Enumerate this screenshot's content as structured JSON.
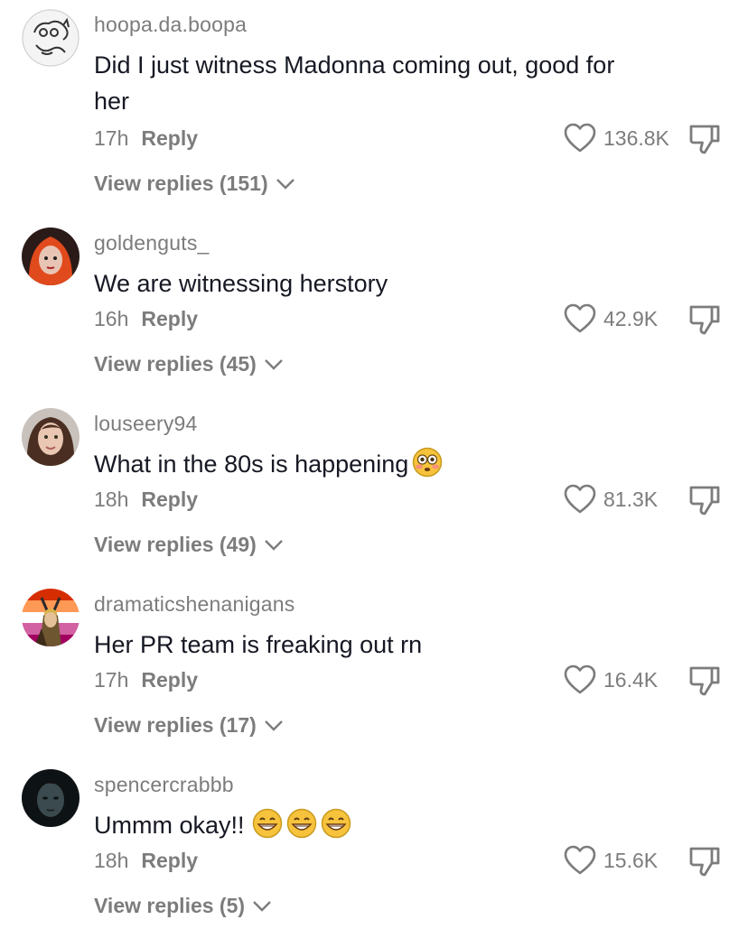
{
  "comments": [
    {
      "username": "hoopa.da.boopa",
      "text": "Did I just witness Madonna coming out, good for her",
      "time": "17h",
      "reply_label": "Reply",
      "likes": "136.8K",
      "view_replies": "View replies (151)",
      "avatar_icon": "cartoon-doodle-avatar"
    },
    {
      "username": "goldenguts_",
      "text": "We are witnessing herstory",
      "time": "16h",
      "reply_label": "Reply",
      "likes": "42.9K",
      "view_replies": "View replies (45)",
      "avatar_icon": "red-hair-avatar"
    },
    {
      "username": "louseery94",
      "text": "What in the 80s is happening",
      "emoji": [
        "flushed-face"
      ],
      "time": "18h",
      "reply_label": "Reply",
      "likes": "81.3K",
      "view_replies": "View replies (49)",
      "avatar_icon": "brown-hair-avatar"
    },
    {
      "username": "dramaticshenanigans",
      "text": "Her PR team is freaking out rn",
      "time": "17h",
      "reply_label": "Reply",
      "likes": "16.4K",
      "view_replies": "View replies (17)",
      "avatar_icon": "lesbian-flag-character-avatar"
    },
    {
      "username": "spencercrabbb",
      "text": "Ummm okay!!",
      "emoji": [
        "grinning-face",
        "grinning-face",
        "grinning-face"
      ],
      "time": "18h",
      "reply_label": "Reply",
      "likes": "15.6K",
      "view_replies": "View replies (5)",
      "avatar_icon": "dark-photo-avatar"
    }
  ],
  "colors": {
    "text": "#161823",
    "secondary": "#7c7c7c",
    "background": "#ffffff"
  }
}
